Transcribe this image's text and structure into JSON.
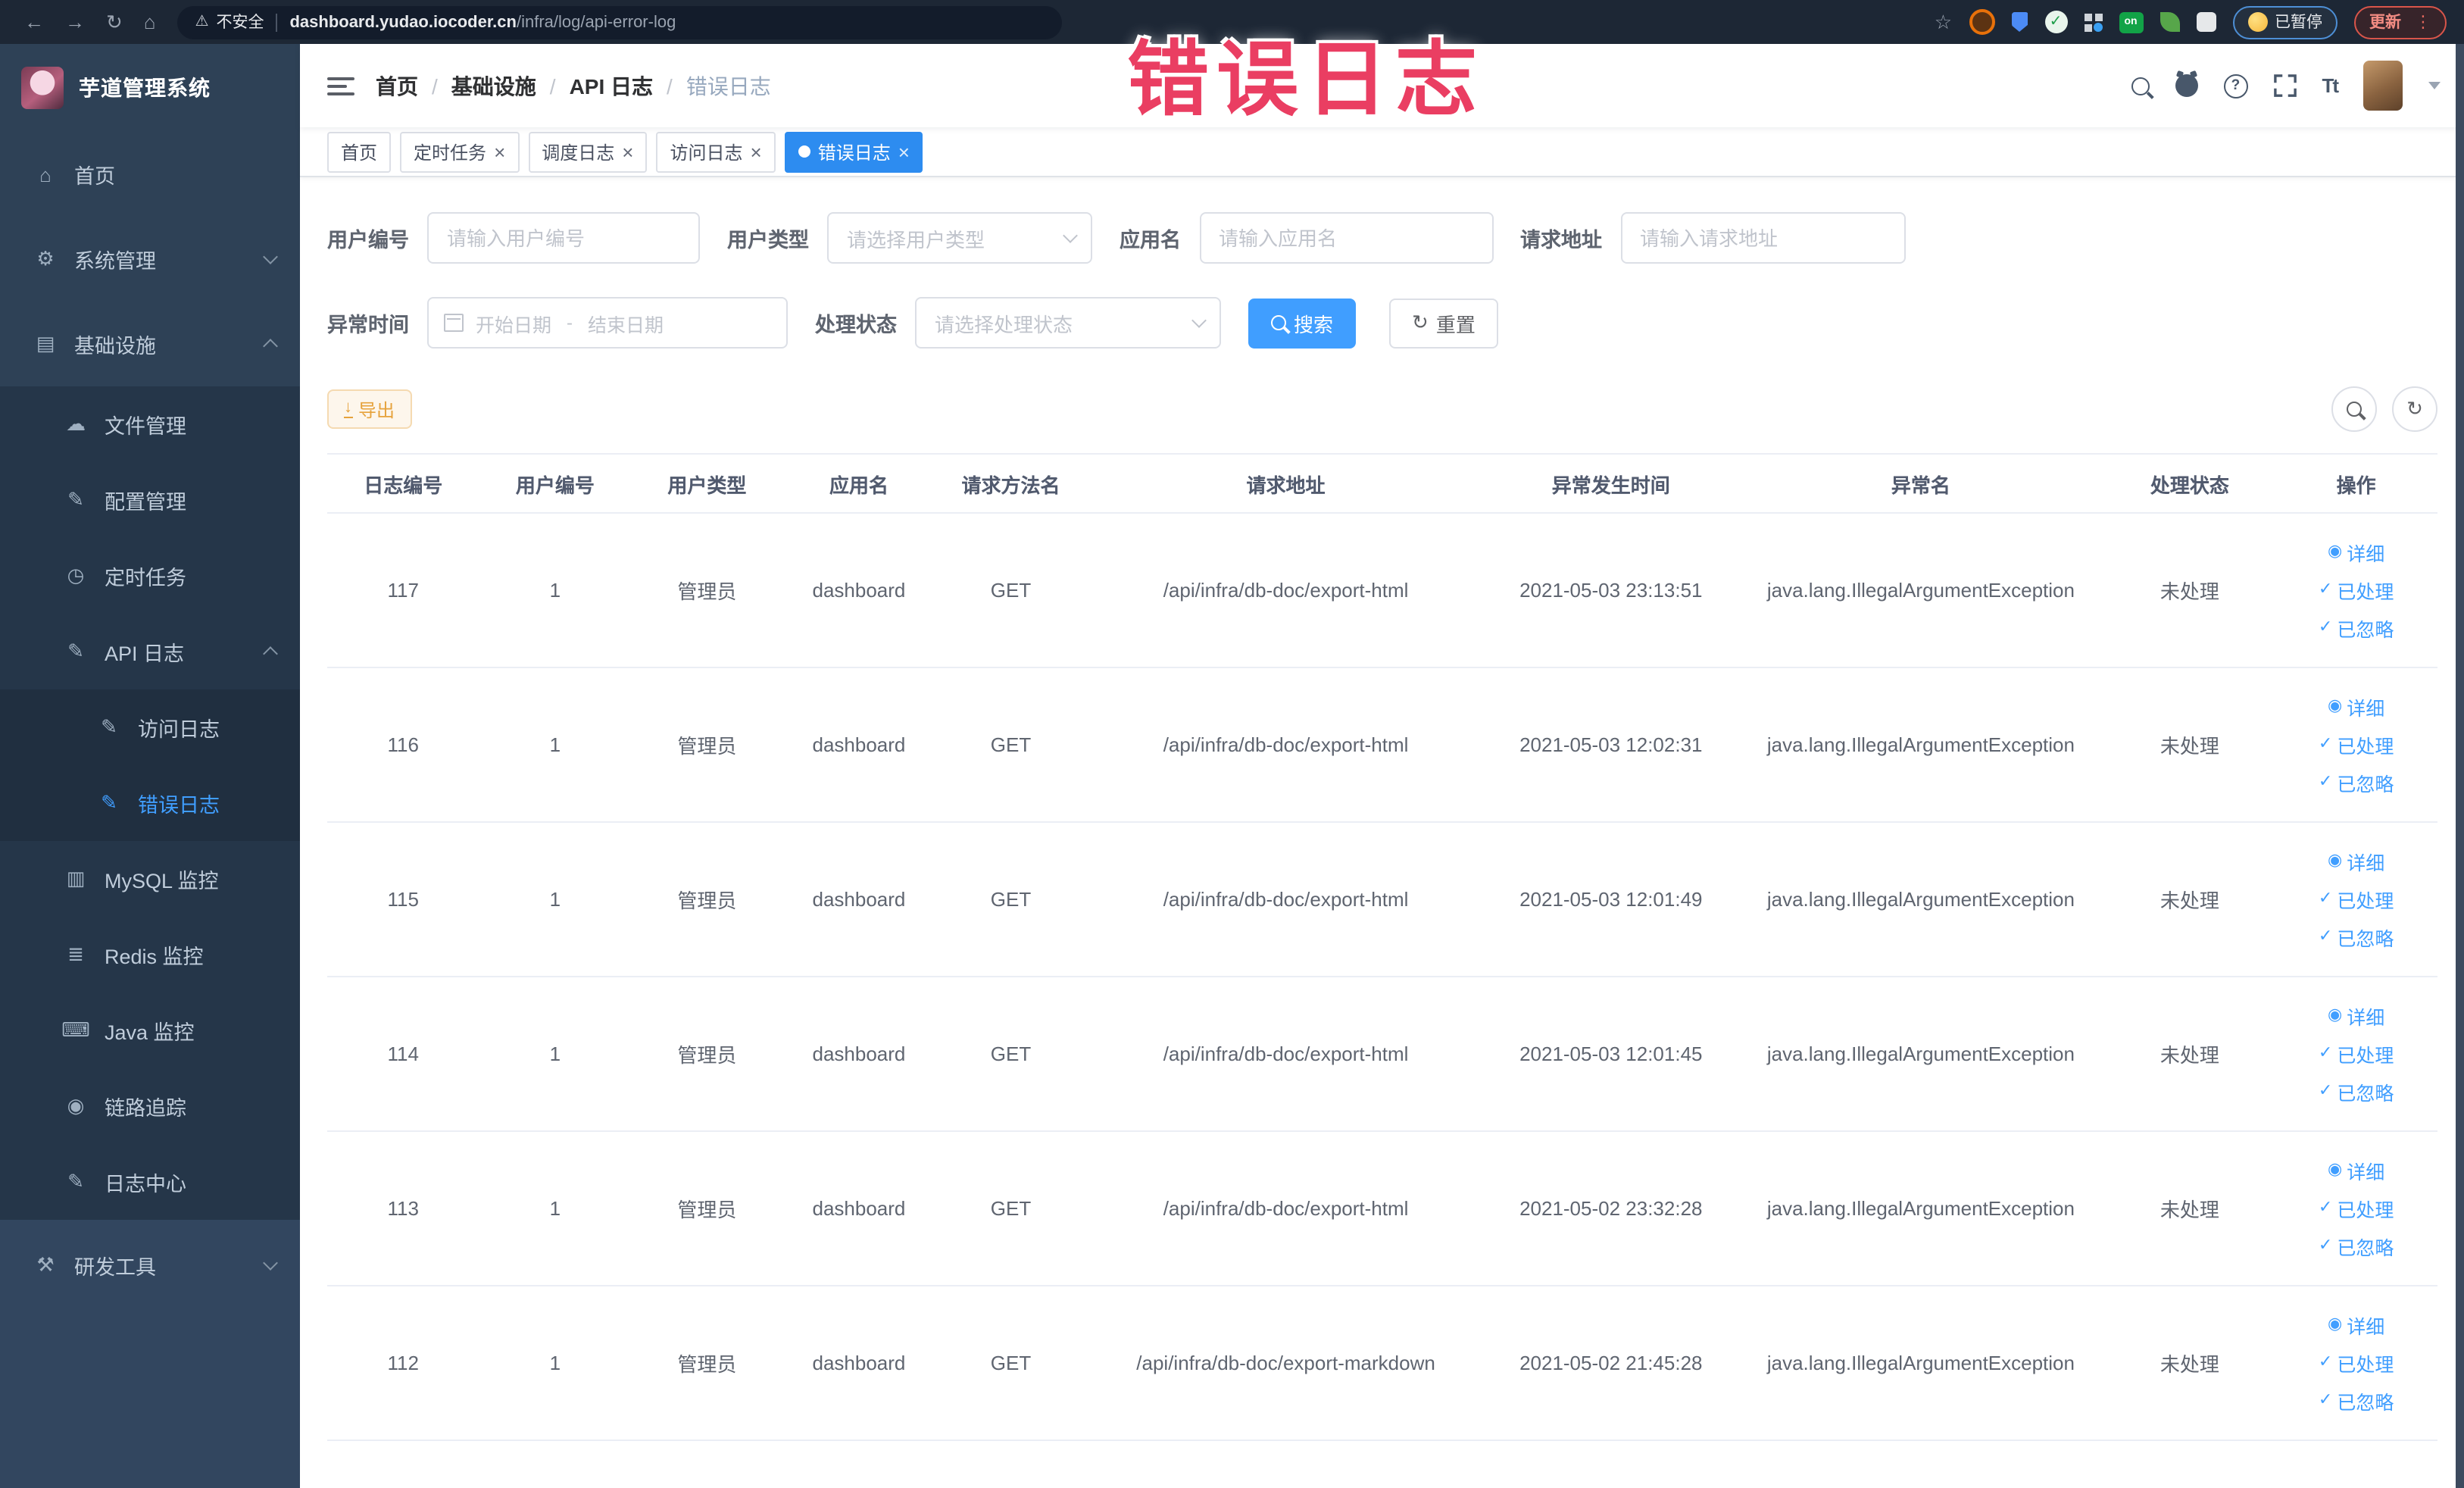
{
  "browser": {
    "security_label": "不安全",
    "url_host": "dashboard.yudao.iocoder.cn",
    "url_path": "/infra/log/api-error-log",
    "on_badge": "on",
    "paused_badge": "已暂停",
    "update_badge": "更新"
  },
  "watermark": {
    "text": "错误日志"
  },
  "sidebar": {
    "title": "芋道管理系统",
    "items": [
      {
        "id": "home",
        "label": "首页",
        "icon": "home-icon",
        "level": 1
      },
      {
        "id": "system",
        "label": "系统管理",
        "icon": "gear-icon",
        "level": 1,
        "chevron": "down"
      },
      {
        "id": "infra",
        "label": "基础设施",
        "icon": "infrastructure-icon",
        "level": 1,
        "chevron": "up"
      },
      {
        "id": "file",
        "label": "文件管理",
        "icon": "file-manage-icon",
        "level": 2
      },
      {
        "id": "config",
        "label": "配置管理",
        "icon": "config-icon",
        "level": 2
      },
      {
        "id": "job",
        "label": "定时任务",
        "icon": "timer-icon",
        "level": 2
      },
      {
        "id": "api-log",
        "label": "API 日志",
        "icon": "api-log-icon",
        "level": 2,
        "chevron": "up"
      },
      {
        "id": "access-log",
        "label": "访问日志",
        "icon": "access-log-icon",
        "level": 3
      },
      {
        "id": "error-log",
        "label": "错误日志",
        "icon": "error-log-icon",
        "level": 3,
        "active": true
      },
      {
        "id": "mysql",
        "label": "MySQL 监控",
        "icon": "mysql-icon",
        "level": 2
      },
      {
        "id": "redis",
        "label": "Redis 监控",
        "icon": "redis-icon",
        "level": 2
      },
      {
        "id": "java",
        "label": "Java 监控",
        "icon": "java-icon",
        "level": 2
      },
      {
        "id": "tracer",
        "label": "链路追踪",
        "icon": "trace-icon",
        "level": 2
      },
      {
        "id": "log-center",
        "label": "日志中心",
        "icon": "log-center-icon",
        "level": 2
      },
      {
        "id": "dev-tools",
        "label": "研发工具",
        "icon": "devtools-icon",
        "level": 1,
        "chevron": "down",
        "section": "bottom"
      }
    ]
  },
  "navbar": {
    "breadcrumb": [
      "首页",
      "基础设施",
      "API 日志",
      "错误日志"
    ]
  },
  "tags": [
    {
      "label": "首页",
      "closable": false,
      "active": false
    },
    {
      "label": "定时任务",
      "closable": true,
      "active": false
    },
    {
      "label": "调度日志",
      "closable": true,
      "active": false
    },
    {
      "label": "访问日志",
      "closable": true,
      "active": false
    },
    {
      "label": "错误日志",
      "closable": true,
      "active": true
    }
  ],
  "filters": {
    "user_id_label": "用户编号",
    "user_id_placeholder": "请输入用户编号",
    "user_type_label": "用户类型",
    "user_type_placeholder": "请选择用户类型",
    "app_name_label": "应用名",
    "app_name_placeholder": "请输入应用名",
    "request_url_label": "请求地址",
    "request_url_placeholder": "请输入请求地址",
    "exception_time_label": "异常时间",
    "date_start_placeholder": "开始日期",
    "date_separator": "-",
    "date_end_placeholder": "结束日期",
    "process_status_label": "处理状态",
    "process_status_placeholder": "请选择处理状态",
    "search_button": "搜索",
    "reset_button": "重置"
  },
  "toolbar": {
    "export_button": "导出"
  },
  "table": {
    "columns": [
      "日志编号",
      "用户编号",
      "用户类型",
      "应用名",
      "请求方法名",
      "请求地址",
      "异常发生时间",
      "异常名",
      "处理状态",
      "操作"
    ],
    "row_actions": [
      "详细",
      "已处理",
      "已忽略"
    ],
    "rows": [
      {
        "log_id": "117",
        "user_id": "1",
        "user_type": "管理员",
        "app_name": "dashboard",
        "method": "GET",
        "url": "/api/infra/db-doc/export-html",
        "time": "2021-05-03 23:13:51",
        "exception": "java.lang.IllegalArgumentException",
        "status": "未处理"
      },
      {
        "log_id": "116",
        "user_id": "1",
        "user_type": "管理员",
        "app_name": "dashboard",
        "method": "GET",
        "url": "/api/infra/db-doc/export-html",
        "time": "2021-05-03 12:02:31",
        "exception": "java.lang.IllegalArgumentException",
        "status": "未处理"
      },
      {
        "log_id": "115",
        "user_id": "1",
        "user_type": "管理员",
        "app_name": "dashboard",
        "method": "GET",
        "url": "/api/infra/db-doc/export-html",
        "time": "2021-05-03 12:01:49",
        "exception": "java.lang.IllegalArgumentException",
        "status": "未处理"
      },
      {
        "log_id": "114",
        "user_id": "1",
        "user_type": "管理员",
        "app_name": "dashboard",
        "method": "GET",
        "url": "/api/infra/db-doc/export-html",
        "time": "2021-05-03 12:01:45",
        "exception": "java.lang.IllegalArgumentException",
        "status": "未处理"
      },
      {
        "log_id": "113",
        "user_id": "1",
        "user_type": "管理员",
        "app_name": "dashboard",
        "method": "GET",
        "url": "/api/infra/db-doc/export-html",
        "time": "2021-05-02 23:32:28",
        "exception": "java.lang.IllegalArgumentException",
        "status": "未处理"
      },
      {
        "log_id": "112",
        "user_id": "1",
        "user_type": "管理员",
        "app_name": "dashboard",
        "method": "GET",
        "url": "/api/infra/db-doc/export-markdown",
        "time": "2021-05-02 21:45:28",
        "exception": "java.lang.IllegalArgumentException",
        "status": "未处理"
      }
    ]
  },
  "icons": {
    "back": "←",
    "forward": "→",
    "reload": "↻",
    "home-nav": "⌂",
    "warning": "⚠",
    "star": "☆",
    "dots": "⋮",
    "home-icon": "⌂",
    "gear-icon": "⚙",
    "infrastructure-icon": "▤",
    "file-manage-icon": "☁",
    "config-icon": "✎",
    "timer-icon": "◷",
    "api-log-icon": "✎",
    "access-log-icon": "✎",
    "error-log-icon": "✎",
    "mysql-icon": "▥",
    "redis-icon": "≣",
    "java-icon": "⌨",
    "trace-icon": "◉",
    "log-center-icon": "✎",
    "devtools-icon": "⚒",
    "close": "×",
    "check": "✓",
    "eye": "◉",
    "refresh": "↻",
    "download": "↓",
    "question": "?",
    "font-size": "Tt"
  },
  "colors": {
    "accent": "#409eff",
    "tag_active": "#2d8cf0",
    "export_text": "#e6a23c",
    "sidebar_bg": "#2e4156",
    "chrome_bg": "#1d2735",
    "watermark": "#ea3e62"
  }
}
